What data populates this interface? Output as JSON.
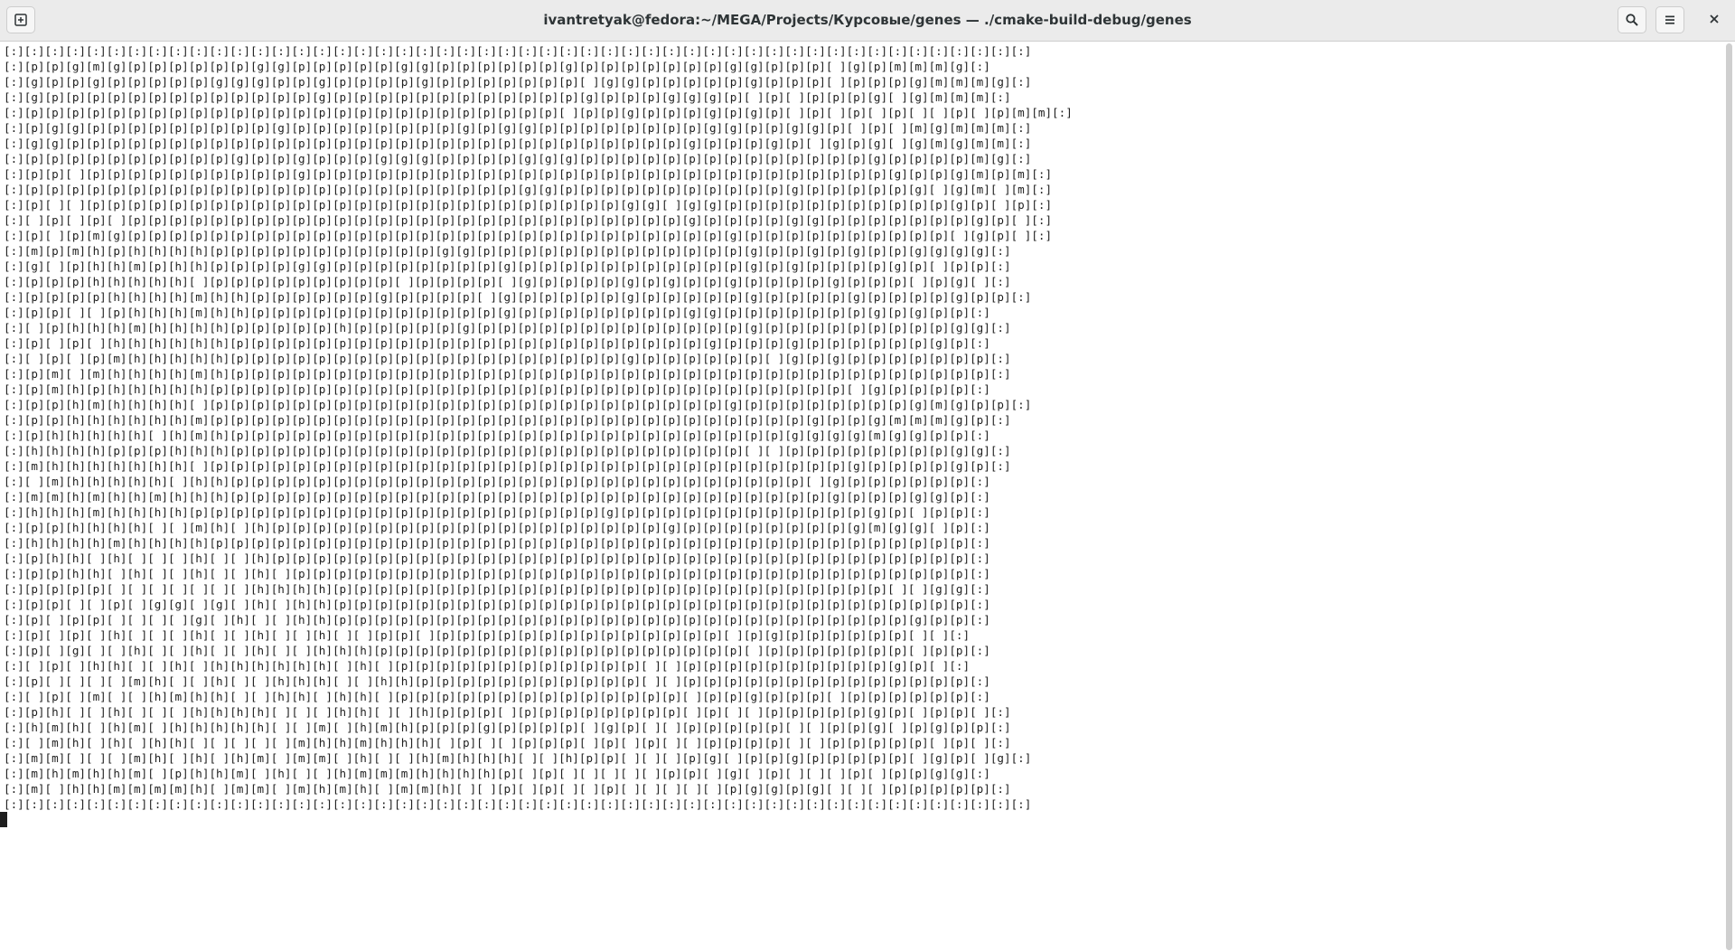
{
  "window": {
    "title": "ivantretyak@fedora:~/MEGA/Projects/Курсовые/genes — ./cmake-build-debug/genes"
  },
  "toolbar": {
    "new_tab_icon": "new-tab-icon",
    "search_icon": "search-icon",
    "menu_icon": "hamburger-menu-icon",
    "close_icon": "close-icon"
  },
  "terminal": {
    "lines": [
      "[:][:][:][:][:][:][:][:][:][:][:][:][:][:][:][:][:][:][:][:][:][:][:][:][:][:][:][:][:][:][:][:][:][:][:][:][:][:][:][:][:][:][:][:][:][:][:][:][:][:]",
      "[:][p][p][g][m][g][p][p][p][p][p][p][g][g][p][p][p][p][p][g][g][p][p][p][p][p][p][g][p][p][p][p][p][p][p][g][g][p][p][p][ ][g][p][m][m][m][g][:]",
      "[:][g][p][p][g][p][p][p][p][p][g][g][g][p][p][g][p][p][p][p][g][p][p][p][p][p][p][p][ ][g][g][p][p][p][p][p][g][p][p][p][ ][p][p][p][g][m][m][m][g][:]",
      "[:][g][p][p][p][p][p][p][p][p][p][p][p][p][p][g][p][p][p][p][p][p][p][p][p][p][p][p][g][p][p][p][g][g][g][p][ ][p][ ][p][p][p][g][ ][g][m][m][m][:]",
      "[:][p][p][p][p][p][p][p][p][p][p][p][p][p][p][p][p][p][p][p][p][p][p][p][p][p][p][ ][p][p][g][p][p][p][g][p][g][p][ ][p][ ][p][ ][p][ ][ ][p][ ][p][m][m][:]",
      "[:][p][g][g][p][p][p][p][p][p][p][p][p][g][p][p][p][p][p][p][p][p][g][p][g][g][p][p][p][p][p][p][p][p][g][g][p][p][g][g][p][ ][p][ ][m][g][m][m][m][:]",
      "[:][g][g][p][p][p][p][p][p][p][p][p][p][p][p][p][p][p][p][p][p][p][p][p][p][p][p][p][p][p][p][p][p][g][p][p][p][g][p][ ][g][p][g][ ][g][m][g][m][m][:]",
      "[:][p][p][p][p][p][p][p][p][p][p][g][p][p][g][p][p][p][g][g][g][p][p][p][p][g][g][g][p][p][p][p][p][p][p][p][p][p][p][p][p][p][g][p][p][p][p][m][g][:]",
      "[:][p][p][ ][p][p][p][p][p][p][p][p][p][p][g][p][p][p][p][p][p][p][p][p][p][p][p][p][p][p][p][p][p][p][p][p][p][p][p][p][p][p][p][g][p][p][g][m][p][m][:]",
      "[:][p][p][p][p][p][p][p][p][p][p][p][p][p][p][p][p][p][p][p][p][p][p][p][p][g][g][p][p][p][p][p][p][p][p][p][p][p][g][p][p][p][p][p][g][ ][g][m][ ][m][:]",
      "[:][p][ ][ ][p][p][p][p][p][p][p][p][p][p][p][p][p][p][p][p][p][p][p][p][p][p][p][p][p][p][g][g][ ][g][g][p][p][p][p][p][p][p][p][p][p][p][g][p][ ][p][:]",
      "[:][ ][p][ ][p][ ][p][p][p][p][p][p][p][p][p][p][p][p][p][p][p][p][p][p][p][p][p][p][p][p][p][p][p][g][p][p][p][p][g][g][p][p][p][p][p][p][p][g][p][ ][:]",
      "[:][p][ ][p][m][g][p][p][p][p][p][p][p][p][p][p][p][p][p][p][p][p][p][p][p][p][p][p][p][p][p][p][p][p][p][g][p][p][p][p][p][p][p][p][p][p][ ][g][p][ ][:]",
      "[:][m][p][m][h][p][h][h][h][h][p][p][p][p][p][p][p][p][p][p][p][g][g][p][p][p][p][p][p][p][p][p][p][p][p][p][g][p][p][g][p][g][p][p][g][g][g][g][:]",
      "[:][g][ ][p][h][h][m][p][h][h][p][p][p][p][g][g][p][p][p][p][p][p][p][p][g][p][p][p][p][p][p][p][p][p][p][p][g][p][g][p][p][p][p][g][p][ ][p][p][:]",
      "[:][p][p][p][h][h][h][h][h][ ][p][p][p][p][p][p][p][p][p][ ][p][p][p][p][ ][g][p][p][p][p][g][p][g][p][p][g][p][p][p][p][g][p][p][p][ ][p][g][ ][:]",
      "[:][p][p][p][p][h][h][h][h][m][h][h][p][p][p][p][p][p][g][p][p][p][p][ ][g][p][p][p][p][p][g][p][p][p][p][p][g][p][p][p][p][g][p][p][p][p][g][p][p][:]",
      "[:][p][p][ ][ ][p][h][h][h][m][h][h][p][p][p][p][p][p][p][p][p][p][p][p][g][p][p][p][p][p][p][p][p][g][g][p][p][p][p][p][p][p][g][p][g][p][p][:]",
      "[:][ ][p][h][h][h][m][h][h][h][h][p][p][p][p][p][h][p][p][p][p][p][g][p][p][p][p][p][p][p][p][p][p][p][p][p][g][p][p][p][p][p][p][p][p][p][g][g][:]",
      "[:][p][ ][p][ ][h][h][h][h][h][h][p][p][p][p][p][p][p][p][p][p][p][p][p][p][p][p][p][p][p][p][p][p][p][g][p][p][p][g][p][p][p][p][p][p][g][p][:]",
      "[:][ ][p][ ][p][m][h][h][h][h][h][p][p][p][p][p][p][p][p][p][p][p][p][p][p][p][p][p][p][p][g][p][p][p][p][p][p][ ][g][p][g][p][p][p][p][p][p][p][:]",
      "[:][p][m][ ][m][h][h][h][h][m][h][p][p][p][p][p][p][p][p][p][p][p][p][p][p][p][p][p][p][p][p][p][p][p][p][p][p][p][p][p][p][p][p][p][p][p][p][p][:]",
      "[:][p][m][h][p][h][h][h][h][h][p][p][p][p][p][p][p][p][p][p][p][p][p][p][p][p][p][p][p][p][p][p][p][p][p][p][p][p][p][p][p][ ][g][p][p][p][p][:]",
      "[:][p][p][h][m][h][h][h][h][ ][p][p][p][p][p][p][p][p][p][p][p][p][p][p][p][p][p][p][p][p][p][p][p][p][p][g][p][p][p][p][p][p][p][p][g][m][g][p][p][:]",
      "[:][p][p][h][h][h][h][h][h][m][p][p][p][p][p][p][p][p][p][p][p][p][p][p][p][p][p][p][p][p][p][p][p][p][p][p][p][p][p][g][p][p][g][m][m][m][g][p][:]",
      "[:][p][h][h][h][h][h][ ][h][m][h][p][p][p][p][p][p][p][p][p][p][p][p][p][p][p][p][p][p][p][p][p][p][p][p][p][p][p][g][g][g][g][m][g][g][p][p][:]",
      "[:][h][h][h][h][p][p][p][h][h][h][p][p][p][p][p][p][p][p][p][p][p][p][p][p][p][p][p][p][p][p][p][p][p][p][p][ ][ ][p][p][p][p][p][p][p][p][g][g][:]",
      "[:][m][h][h][h][h][h][h][h][ ][p][p][p][p][p][p][p][p][p][p][p][p][p][p][p][p][p][p][p][p][p][p][p][p][p][p][p][p][p][p][p][g][p][p][p][p][g][p][:]",
      "[:][ ][m][h][h][h][h][h][ ][h][h][p][p][p][p][p][p][p][p][p][p][p][p][p][p][p][p][p][p][p][p][p][p][p][p][p][p][p][p][ ][g][p][p][p][p][p][p][:]",
      "[:][m][m][h][m][h][h][m][h][h][h][p][p][p][p][p][p][p][p][p][p][p][p][p][p][p][p][p][p][p][p][p][p][p][p][p][p][p][p][p][g][p][p][p][g][g][p][:]",
      "[:][h][h][h][m][h][h][h][h][p][p][p][p][p][p][p][p][p][p][p][p][p][p][p][p][p][p][p][p][g][p][p][p][p][p][p][p][p][p][p][p][p][g][p][ ][p][p][:]",
      "[:][p][p][h][h][h][h][ ][ ][m][h][ ][h][p][p][p][p][p][p][p][p][p][p][p][p][p][p][p][p][p][p][p][g][p][p][p][p][p][p][p][p][g][m][g][g][ ][p][:]",
      "[:][h][h][h][h][m][h][h][h][h][p][p][p][p][p][p][p][p][p][p][p][p][p][p][p][p][p][p][p][p][p][p][p][p][p][p][p][p][p][p][p][p][p][p][p][p][p][:]",
      "[:][p][h][h][ ][h][ ][ ][ ][h][ ][ ][h][p][p][p][p][p][p][p][p][p][p][p][p][p][p][p][p][p][p][p][p][p][p][p][p][p][p][p][p][p][p][p][p][p][p][:]",
      "[:][p][p][h][h][ ][h][ ][ ][h][ ][ ][h][ ][p][p][p][p][p][p][p][p][p][p][p][p][p][p][p][p][p][p][p][p][p][p][p][p][p][p][p][p][p][p][p][p][p][:]",
      "[:][p][p][p][p][ ][ ][ ][ ][ ][ ][ ][h][h][h][h][p][p][p][p][p][p][p][p][p][p][p][p][p][p][p][p][p][p][p][p][p][p][p][p][p][p][p][ ][ ][g][g][:]",
      "[:][p][p][ ][ ][p][ ][g][g][ ][g][ ][h][ ][h][h][p][p][p][p][p][p][p][p][p][p][p][p][p][p][p][p][p][p][p][p][p][p][p][p][p][p][p][p][p][p][p][:]",
      "[:][p][ ][p][p][ ][ ][ ][ ][g][ ][h][ ][ ][h][h][p][p][p][p][p][p][p][p][p][p][p][p][p][p][p][p][p][p][p][p][p][p][p][p][p][p][p][p][g][p][p][:]",
      "[:][p][ ][p][ ][h][ ][ ][ ][h][ ][ ][h][ ][ ][h][ ][ ][p][p][ ][p][p][p][p][p][p][p][p][p][p][p][p][p][p][ ][p][g][p][p][p][p][p][p][ ][ ][:]",
      "[:][p][ ][g][ ][ ][h][ ][ ][h][ ][ ][h][ ][ ][h][h][h][p][p][p][p][p][p][p][p][p][p][p][p][p][p][p][p][p][p][ ][p][p][p][p][p][p][p][ ][p][p][:]",
      "[:][ ][p][ ][h][h][ ][ ][h][ ][h][h][h][h][h][h][ ][h][ ][p][p][p][p][p][p][p][p][p][p][p][p][ ][ ][p][p][p][p][p][p][p][p][p][p][g][p][ ][:]",
      "[:][p][ ][ ][ ][ ][m][h][ ][ ][h][ ][ ][h][h][h][ ][ ][h][h][p][p][p][p][p][p][p][p][p][p][p][ ][ ][p][p][p][p][p][p][p][p][p][p][p][p][p][p][:]",
      "[:][ ][p][ ][m][ ][ ][h][m][h][h][ ][ ][h][h][ ][h][h][ ][p][p][p][p][p][p][p][p][p][p][p][p][p][p][ ][p][p][g][p][p][p][ ][p][p][p][p][p][p][:]",
      "[:][p][h][ ][ ][h][ ][ ][ ][h][h][h][h][ ][ ][ ][h][h][ ][ ][h][p][p][p][ ][p][p][p][p][p][p][p][p][ ][p][ ][ ][p][p][p][p][p][g][p][ ][p][p][ ][:]",
      "[:][h][m][h][ ][h][m][ ][h][h][h][h][h][ ][ ][m][ ][h][m][h][p][p][p][g][p][p][p][p][ ][g][p][ ][ ][p][p][p][p][p][ ][ ][p][p][g][ ][p][g][p][p][:]",
      "[:][ ][m][h][ ][h][ ][h][h][ ][ ][ ][ ][ ][m][h][h][m][h][h][h][ ][p][ ][ ][p][p][p][ ][p][ ][p][ ][ ][p][p][p][p][ ][ ][p][p][p][p][p][ ][p][ ][:]",
      "[:][m][m][ ][ ][ ][m][h][ ][h][ ][h][m][ ][m][m][ ][h][ ][ ][h][m][h][h][h][ ][ ][h][p][p][ ][ ][ ][p][g][ ][p][p][g][p][p][p][p][p][ ][g][p][ ][g][:]",
      "[:][m][h][m][h][h][m][ ][p][h][h][m][ ][h][ ][ ][h][m][m][m][h][h][h][h][p][ ][p][ ][ ][ ][ ][ ][p][p][ ][g][ ][p][ ][ ][ ][p][ ][p][p][g][g][:]",
      "[:][m][ ][h][h][m][m][m][m][h][ ][m][m][ ][m][h][m][h][ ][m][m][h][ ][ ][p][ ][p][ ][ ][p][ ][ ][ ][ ][ ][p][g][g][p][g][ ][ ][ ][p][p][p][p][p][:]",
      "[:][:][:][:][:][:][:][:][:][:][:][:][:][:][:][:][:][:][:][:][:][:][:][:][:][:][:][:][:][:][:][:][:][:][:][:][:][:][:][:][:][:][:][:][:][:][:][:][:][:]"
    ]
  }
}
